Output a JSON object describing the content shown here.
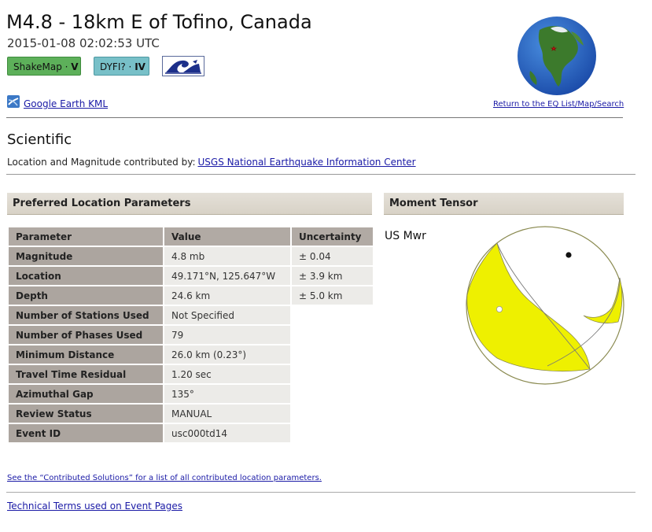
{
  "event": {
    "title": "M4.8 - 18km E of Tofino, Canada",
    "datetime": "2015-01-08 02:02:53 UTC"
  },
  "badges": {
    "shakemap_label": "ShakeMap",
    "shakemap_sep": " · ",
    "shakemap_level": "V",
    "shakemap_color": "#5db05a",
    "dyfi_label": "DYFI?",
    "dyfi_sep": " · ",
    "dyfi_level": "IV",
    "dyfi_color": "#78c0c8",
    "tsunami_icon": "tsunami-wave-icon"
  },
  "links": {
    "kml": "Google Earth KML",
    "return": "Return to the EQ List/Map/Search",
    "contributed": "See the “Contributed Solutions” for a list of all contributed location parameters.",
    "terms": "Technical Terms used on Event Pages"
  },
  "scientific": {
    "heading": "Scientific",
    "contrib_prefix": "Location and Magnitude contributed by:",
    "contrib_link": "USGS National Earthquake Information Center"
  },
  "location_section": {
    "title": "Preferred Location Parameters",
    "columns": [
      "Parameter",
      "Value",
      "Uncertainty"
    ],
    "rows": [
      {
        "param": "Magnitude",
        "value": "4.8 mb",
        "uncertainty": "± 0.04"
      },
      {
        "param": "Location",
        "value": "49.171°N, 125.647°W",
        "uncertainty": "± 3.9 km"
      },
      {
        "param": "Depth",
        "value": "24.6 km",
        "uncertainty": "± 5.0 km"
      },
      {
        "param": "Number of Stations Used",
        "value": "Not Specified",
        "uncertainty": ""
      },
      {
        "param": "Number of Phases Used",
        "value": "79",
        "uncertainty": ""
      },
      {
        "param": "Minimum Distance",
        "value": "26.0 km (0.23°)",
        "uncertainty": ""
      },
      {
        "param": "Travel Time Residual",
        "value": "1.20 sec",
        "uncertainty": ""
      },
      {
        "param": "Azimuthal Gap",
        "value": "135°",
        "uncertainty": ""
      },
      {
        "param": "Review Status",
        "value": "MANUAL",
        "uncertainty": ""
      },
      {
        "param": "Event ID",
        "value": "usc000td14",
        "uncertainty": ""
      }
    ]
  },
  "moment_tensor": {
    "title": "Moment Tensor",
    "label": "US Mwr",
    "beachball_fill": "#eef000"
  }
}
